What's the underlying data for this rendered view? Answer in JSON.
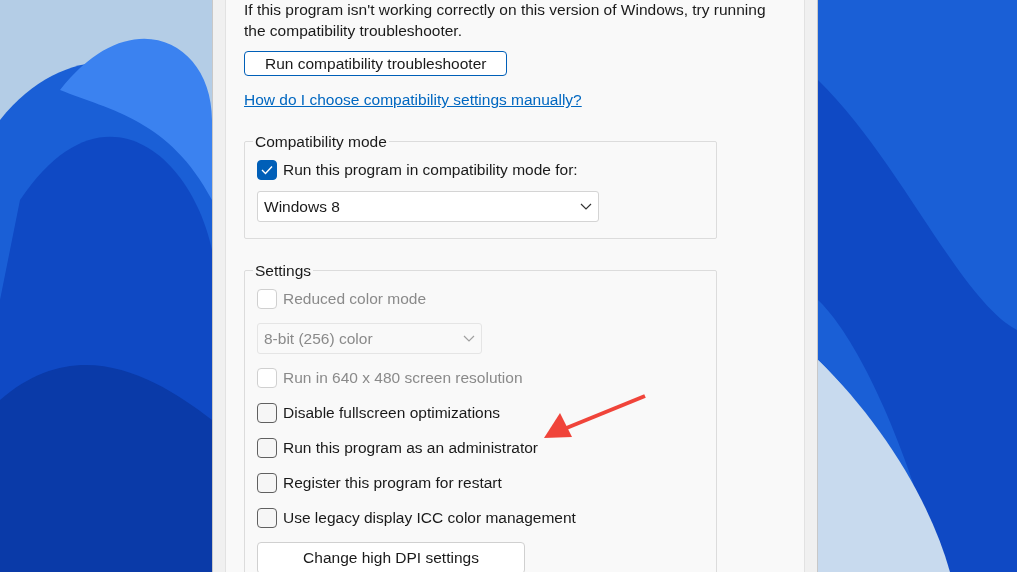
{
  "intro": {
    "text": "If this program isn't working correctly on this version of Windows, try running the compatibility troubleshooter.",
    "button": "Run compatibility troubleshooter",
    "link": "How do I choose compatibility settings manually?"
  },
  "compatibility_mode": {
    "title": "Compatibility mode",
    "checkbox": {
      "label": "Run this program in compatibility mode for:",
      "checked": true,
      "disabled": false
    },
    "dropdown": {
      "value": "Windows 8",
      "disabled": false
    }
  },
  "settings": {
    "title": "Settings",
    "items": [
      {
        "kind": "checkbox",
        "label": "Reduced color mode",
        "checked": false,
        "disabled": true
      },
      {
        "kind": "dropdown",
        "value": "8-bit (256) color",
        "disabled": true
      },
      {
        "kind": "checkbox",
        "label": "Run in 640 x 480 screen resolution",
        "checked": false,
        "disabled": true
      },
      {
        "kind": "checkbox",
        "label": "Disable fullscreen optimizations",
        "checked": false,
        "disabled": false
      },
      {
        "kind": "checkbox",
        "label": "Run this program as an administrator",
        "checked": false,
        "disabled": false
      },
      {
        "kind": "checkbox",
        "label": "Register this program for restart",
        "checked": false,
        "disabled": false
      },
      {
        "kind": "checkbox",
        "label": "Use legacy display ICC color management",
        "checked": false,
        "disabled": false
      },
      {
        "kind": "button",
        "label": "Change high DPI settings"
      }
    ]
  }
}
